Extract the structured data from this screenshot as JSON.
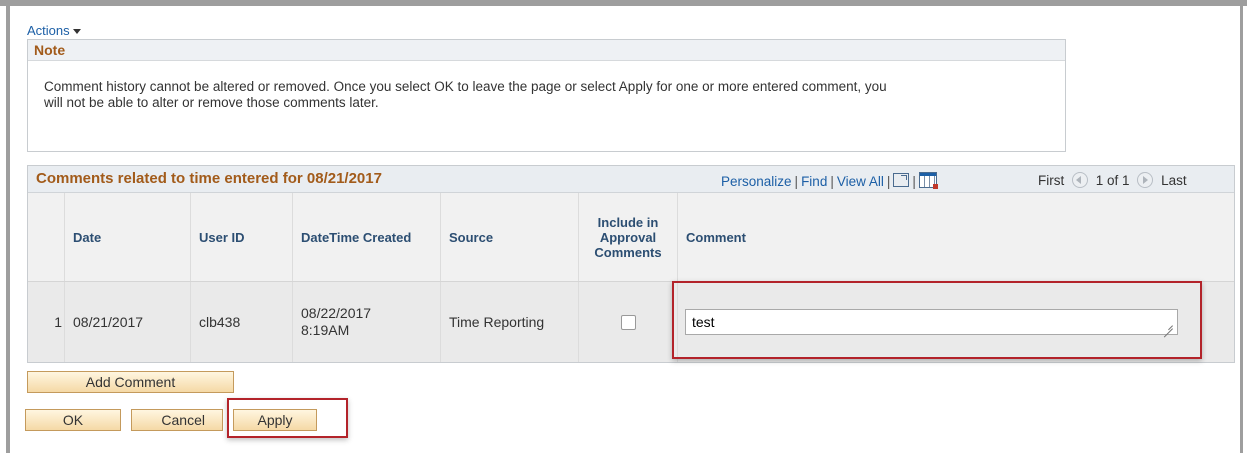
{
  "actions_label": "Actions",
  "note": {
    "title": "Note",
    "line1": "Comment history cannot be altered or removed. Once you select OK to leave the page or select Apply for one or more entered comment, you",
    "line2": "will not be able to alter or remove those comments later."
  },
  "grid": {
    "title": "Comments related to time entered for 08/21/2017",
    "tools": {
      "personalize": "Personalize",
      "find": "Find",
      "view_all": "View All",
      "sep": "|"
    },
    "nav": {
      "first": "First",
      "count": "1 of 1",
      "last": "Last"
    },
    "columns": {
      "date": "Date",
      "user_id": "User ID",
      "datetime_created": "DateTime Created",
      "source": "Source",
      "include": [
        "Include in",
        "Approval",
        "Comments"
      ],
      "comment": "Comment"
    },
    "rows": [
      {
        "num": "1",
        "date": "08/21/2017",
        "user_id": "clb438",
        "datetime_line1": "08/22/2017",
        "datetime_line2": "8:19AM",
        "source": "Time Reporting",
        "include_checked": false,
        "comment": "test"
      }
    ]
  },
  "buttons": {
    "add_comment": "Add Comment",
    "ok": "OK",
    "cancel": "Cancel",
    "apply": "Apply"
  },
  "colors": {
    "highlight": "#b3232a",
    "link": "#1c5fa6",
    "title": "#a25b1a",
    "column_header": "#2c4e72"
  }
}
